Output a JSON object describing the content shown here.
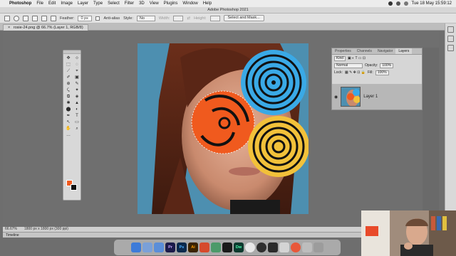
{
  "menubar": {
    "apple": "",
    "app": "Photoshop",
    "items": [
      "File",
      "Edit",
      "Image",
      "Layer",
      "Type",
      "Select",
      "Filter",
      "3D",
      "View",
      "Plugins",
      "Window",
      "Help"
    ],
    "clock": "Tue 18 May  15:59:12"
  },
  "window": {
    "title": "Adobe Photoshop 2021"
  },
  "options": {
    "feather_label": "Feather:",
    "feather_value": "0 px",
    "antialias_label": "Anti-alias",
    "style_label": "Style:",
    "style_value": "No",
    "width_label": "Width:",
    "height_label": "Height:",
    "select_mask_label": "Select and Mask..."
  },
  "document": {
    "tab_title": "rosie-24.png @ 66.7% (Layer 1, RGB/8)",
    "close_glyph": "×"
  },
  "tools": {
    "glyphs": [
      "✥",
      "⊹",
      "⬚",
      "◌",
      "⟋",
      "⌖",
      "✐",
      "▣",
      "⊕",
      "✎",
      "⤹",
      "✦",
      "⧉",
      "◈",
      "✱",
      "▲",
      "⬤",
      "◐",
      "✒",
      "T",
      "↖",
      "▭",
      "✋",
      "⌕",
      "…",
      ""
    ]
  },
  "layers_panel": {
    "tabs": [
      "Properties",
      "Channels",
      "Navigator",
      "Layers"
    ],
    "active_tab": "Layers",
    "kind_label": "Kind",
    "blend_mode": "Normal",
    "opacity_label": "Opacity:",
    "opacity_value": "100%",
    "lock_label": "Lock:",
    "fill_label": "Fill:",
    "fill_value": "100%",
    "layer_name": "Layer 1"
  },
  "status": {
    "zoom": "66.67%",
    "doc_size": "1800 px x 1800 px (300 ppi)"
  },
  "timeline": {
    "label": "Timeline"
  },
  "dock": {
    "apps": [
      {
        "label": "",
        "color": "#3d7bd9",
        "icon": "finder-icon"
      },
      {
        "label": "",
        "color": "#7aa0d8",
        "icon": "launchpad-icon"
      },
      {
        "label": "",
        "color": "#5b8ed8",
        "icon": "safari-icon"
      },
      {
        "label": "Pr",
        "color": "#1b1b4a",
        "icon": "premiere-icon"
      },
      {
        "label": "Ps",
        "color": "#0b2a4d",
        "icon": "photoshop-icon"
      },
      {
        "label": "Ai",
        "color": "#3a2300",
        "icon": "illustrator-icon"
      },
      {
        "label": "",
        "color": "#d64a2c",
        "icon": "red-app-icon"
      },
      {
        "label": "",
        "color": "#4c9a6a",
        "icon": "green-app-icon"
      },
      {
        "label": "",
        "color": "#1a1a1a",
        "icon": "cinema-icon"
      },
      {
        "label": "Dw",
        "color": "#0c3a2e",
        "icon": "dreamweaver-icon"
      },
      {
        "label": "",
        "color": "#e8e8e8",
        "icon": "chrome-icon"
      },
      {
        "label": "",
        "color": "#2f2f2f",
        "icon": "obs-icon"
      },
      {
        "label": "",
        "color": "#2a2a2a",
        "icon": "terminal-icon"
      },
      {
        "label": "",
        "color": "#d4d4d4",
        "icon": "preview-icon"
      },
      {
        "label": "",
        "color": "#e8583a",
        "icon": "red-circle-icon"
      },
      {
        "label": "",
        "color": "#bdbdbd",
        "icon": "folder-icon"
      },
      {
        "label": "",
        "color": "#9c9c9c",
        "icon": "trash-icon"
      }
    ]
  },
  "colors": {
    "foreground": "#f05a1e",
    "background": "#111111",
    "circle_blue": "#3aa9e6",
    "circle_orange": "#f05a1e",
    "circle_yellow": "#f2c13a",
    "sky": "#4d8fb0"
  }
}
